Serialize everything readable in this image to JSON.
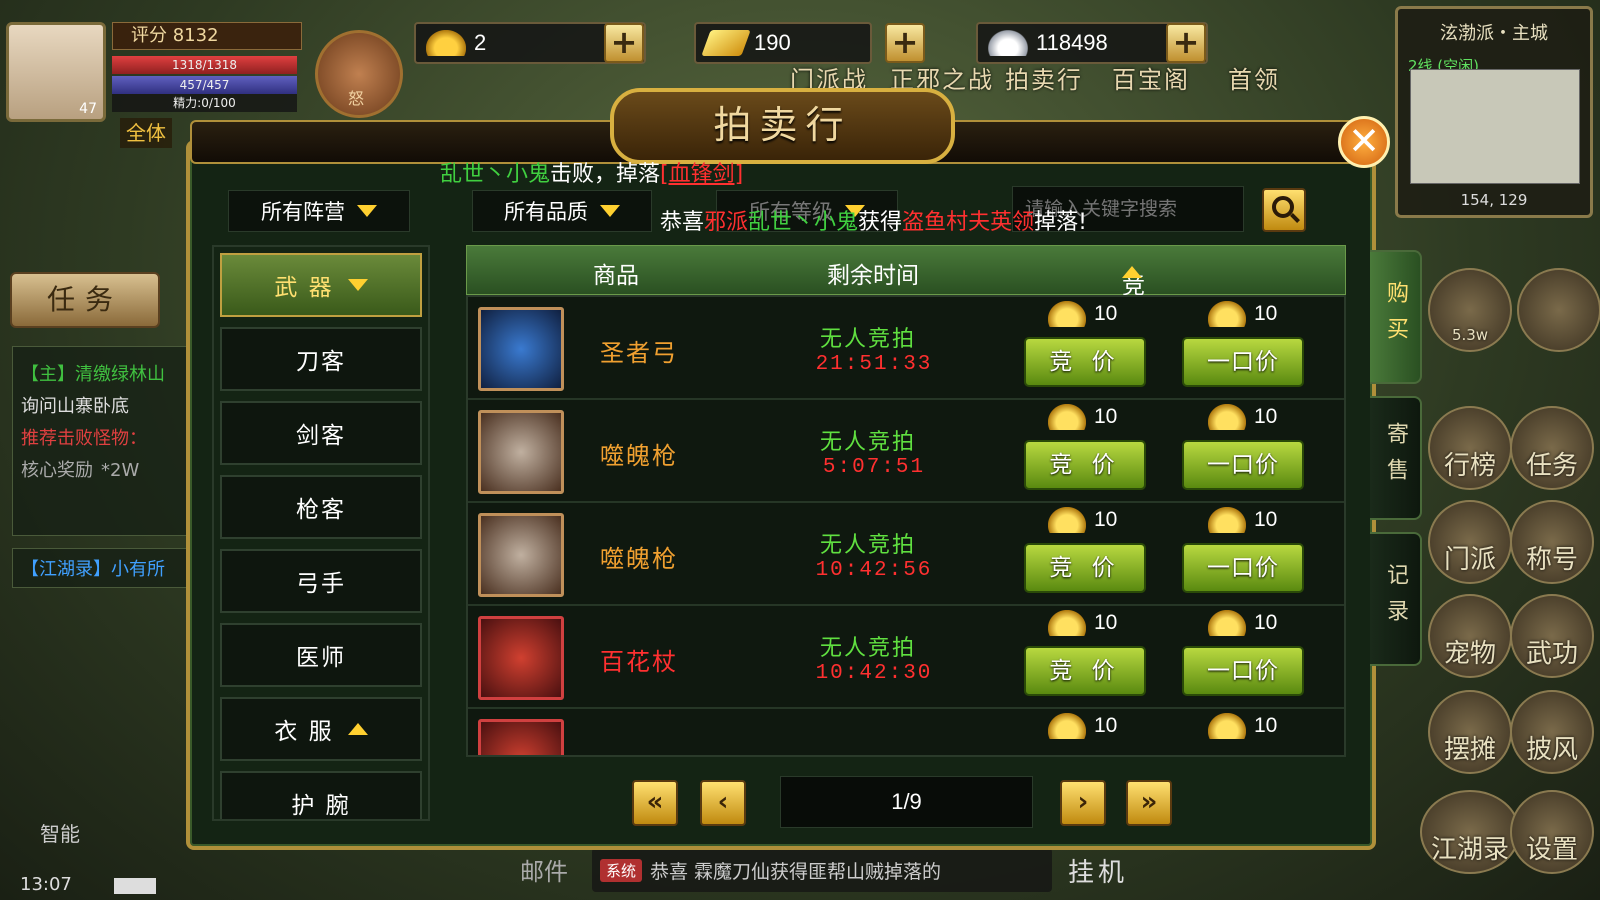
{
  "hud": {
    "level": "47",
    "score": "评分 8132",
    "hp": "1318/1318",
    "mp": "457/457",
    "energy": "精力:0/100",
    "rage": "怒",
    "all_label": "全体",
    "gold_ingot": "2",
    "gold_bar": "190",
    "silver": "118498",
    "nav": [
      "门派战",
      "正邪之战",
      "拍卖行",
      "百宝阁",
      "首领"
    ]
  },
  "minimap": {
    "title": "泫渤派・主城",
    "line": "2线 (空闲)",
    "coords": "154, 129"
  },
  "quest": {
    "button": "任务",
    "main": "【主】清缴绿林山",
    "sub": "询问山寨卧底",
    "recommend": "推荐击败怪物：",
    "reward_label": "核心奖励",
    "reward_value": "*2W",
    "jianghu": "【江湖录】小有所",
    "smart": "智能"
  },
  "status": {
    "time": "13:07"
  },
  "right_icons": [
    "5.3w",
    "行榜",
    "任务",
    "门派",
    "称号",
    "宠物",
    "武功",
    "摆摊",
    "披风",
    "江湖录",
    "设置"
  ],
  "chat": {
    "mail": "邮件",
    "tag": "系统",
    "text": "恭喜 霖魔刀仙获得匪帮山贼掉落的",
    "idle": "挂机"
  },
  "panel": {
    "title": "拍卖行",
    "system_line": {
      "a": "乱世丶小鬼",
      "b": "击败，掉落",
      "c": "[血锋剑]"
    },
    "congrats": {
      "a": "恭喜",
      "b": "邪派",
      "c": "乱世丶小鬼",
      "d": "获得",
      "e": "盗鱼村",
      "f": "夫英领",
      "g": "掉落!"
    },
    "filters": {
      "camp": "所有阵营",
      "quality": "所有品质",
      "level": "所有等级"
    },
    "search_placeholder": "请输入关键字搜索",
    "categories": [
      {
        "label": "武 器",
        "active": true,
        "arrow": "down"
      },
      {
        "label": "刀客"
      },
      {
        "label": "剑客"
      },
      {
        "label": "枪客"
      },
      {
        "label": "弓手"
      },
      {
        "label": "医师"
      },
      {
        "label": "衣 服",
        "arrow": "up"
      },
      {
        "label": "护 腕"
      }
    ],
    "columns": {
      "item": "商品",
      "time": "剩余时间",
      "price": "竞拍价格"
    },
    "rows": [
      {
        "name": "圣者弓",
        "color": "#f0a030",
        "status": "无人竞拍",
        "time": "21:51:33",
        "bid": "10",
        "buyout": "10"
      },
      {
        "name": "噬魄枪",
        "color": "#f0a030",
        "status": "无人竞拍",
        "time": "5:07:51",
        "bid": "10",
        "buyout": "10"
      },
      {
        "name": "噬魄枪",
        "color": "#f0a030",
        "status": "无人竞拍",
        "time": "10:42:56",
        "bid": "10",
        "buyout": "10"
      },
      {
        "name": "百花杖",
        "color": "#ff3030",
        "status": "无人竞拍",
        "time": "10:42:30",
        "bid": "10",
        "buyout": "10"
      },
      {
        "name": "",
        "color": "#f0a030",
        "status": "",
        "time": "",
        "bid": "10",
        "buyout": "10"
      }
    ],
    "bid_label": "竞 价",
    "buyout_label": "一口价",
    "tabs": [
      "购买",
      "寄售",
      "记录"
    ],
    "page": "1/9"
  }
}
